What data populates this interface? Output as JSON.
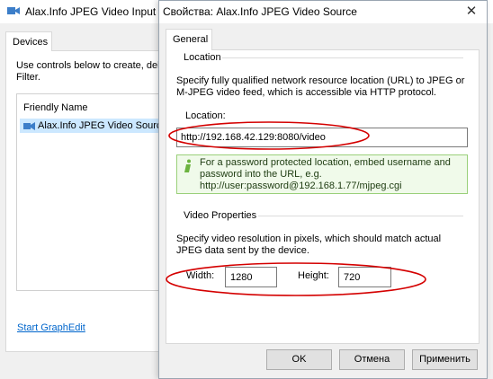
{
  "background_window": {
    "title": "Alax.Info JPEG Video Input D",
    "tab_label": "Devices",
    "description": "Use controls below to create, del Filter.",
    "list_header": "Friendly Name",
    "list_item": "Alax.Info JPEG Video Source",
    "link_label": "Start GraphEdit"
  },
  "dialog": {
    "title": "Свойства: Alax.Info JPEG Video Source",
    "close_glyph": "✕",
    "tab_label": "General",
    "location": {
      "group_title": "Location",
      "description": "Specify fully qualified network resource location (URL) to JPEG or M-JPEG video feed, which is accessible via HTTP protocol.",
      "field_label": "Location:",
      "field_value": "http://192.168.42.129:8080/video",
      "info_text": "For a password protected location, embed username and password into the URL, e.g. http://user:password@192.168.1.77/mjpeg.cgi"
    },
    "video_properties": {
      "group_title": "Video Properties",
      "description": "Specify video resolution in pixels, which should match actual JPEG data sent by the device.",
      "width_label": "Width:",
      "width_value": "1280",
      "height_label": "Height:",
      "height_value": "720"
    },
    "buttons": {
      "ok": "OK",
      "cancel": "Отмена",
      "apply": "Применить"
    }
  },
  "colors": {
    "annotation_red": "#d40000",
    "link_blue": "#0066cc",
    "info_green": "#9ad07a"
  },
  "icons": {
    "app_icon": "camera-icon",
    "info_icon": "info-icon",
    "list_item_icon": "camera-icon"
  }
}
